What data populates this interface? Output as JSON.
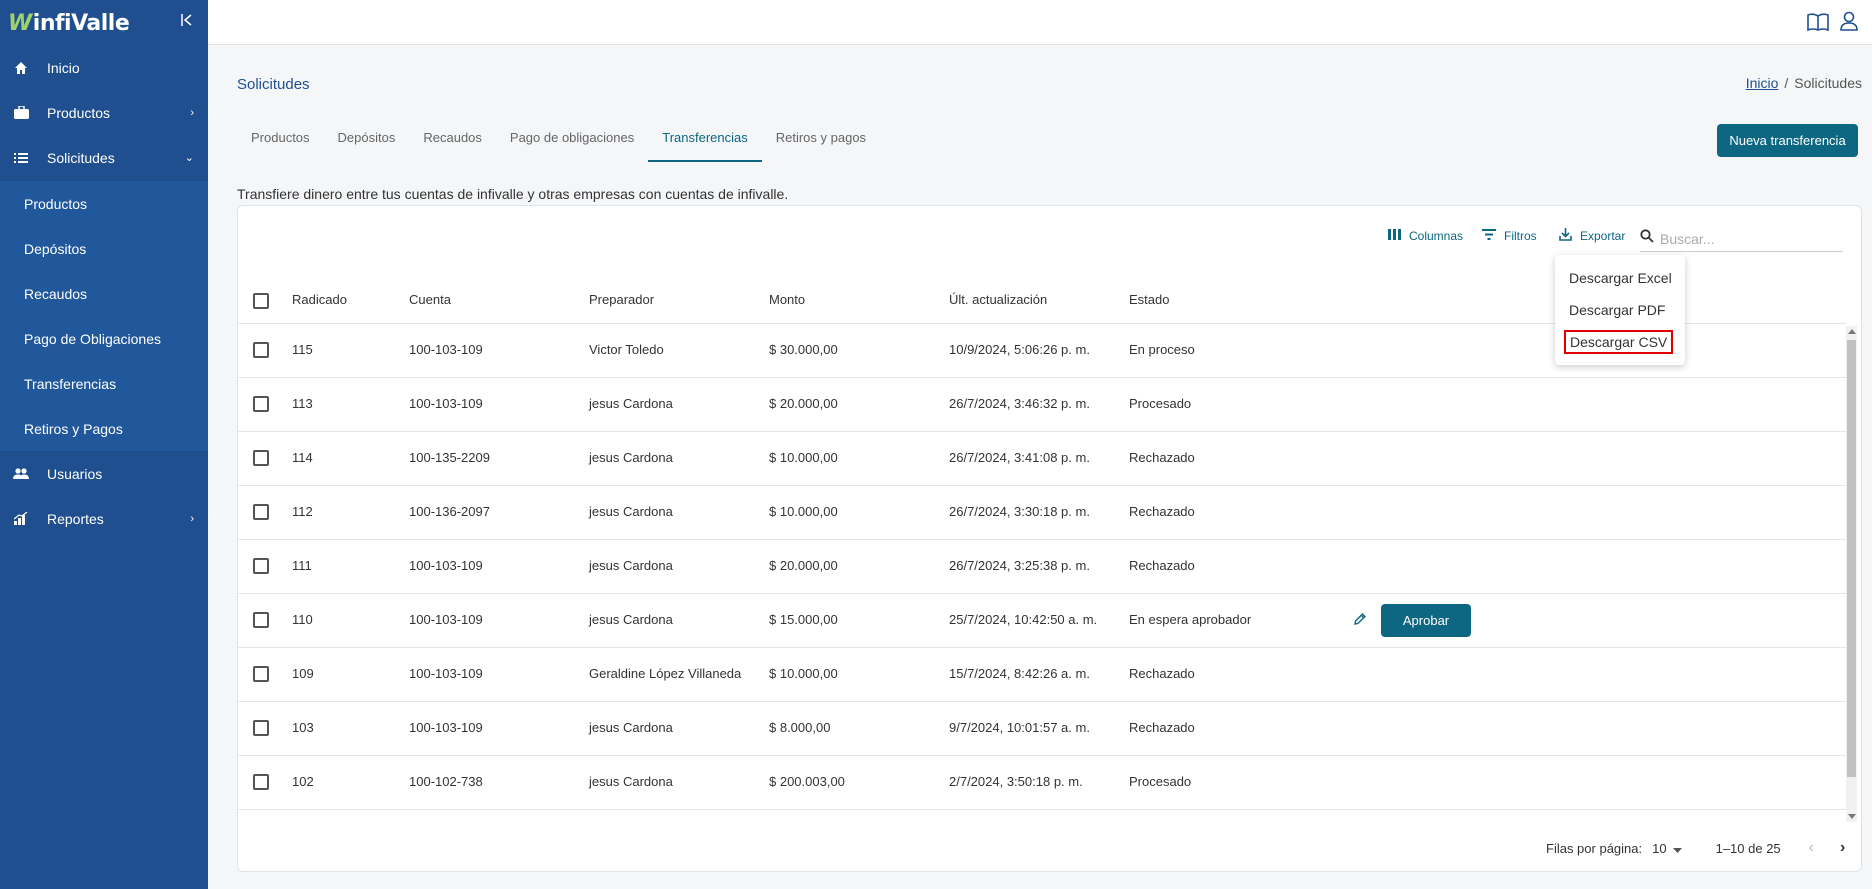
{
  "sidebar": {
    "logo_text": "infiValle",
    "nav": [
      {
        "label": "Inicio",
        "icon": "home-icon"
      },
      {
        "label": "Productos",
        "icon": "briefcase-icon",
        "chevron": "›"
      },
      {
        "label": "Solicitudes",
        "icon": "list-icon",
        "chevron": "⌄"
      },
      {
        "label": "Usuarios",
        "icon": "users-icon"
      },
      {
        "label": "Reportes",
        "icon": "bar-chart-icon",
        "chevron": "›"
      }
    ],
    "sub_items": [
      "Productos",
      "Depósitos",
      "Recaudos",
      "Pago de Obligaciones",
      "Transferencias",
      "Retiros y Pagos"
    ]
  },
  "header": {
    "page_title": "Solicitudes",
    "breadcrumb": {
      "home": "Inicio",
      "separator": "/",
      "current": "Solicitudes"
    }
  },
  "tabs": [
    "Productos",
    "Depósitos",
    "Recaudos",
    "Pago de obligaciones",
    "Transferencias",
    "Retiros y pagos"
  ],
  "active_tab": "Transferencias",
  "new_button": "Nueva transferencia",
  "description": "Transfiere dinero entre tus cuentas de infivalle y otras empresas con cuentas de infivalle.",
  "toolbar": {
    "columns": "Columnas",
    "filters": "Filtros",
    "export": "Exportar",
    "search_placeholder": "Buscar..."
  },
  "export_menu": [
    "Descargar Excel",
    "Descargar PDF",
    "Descargar CSV"
  ],
  "table": {
    "headers": [
      "Radicado",
      "Cuenta",
      "Preparador",
      "Monto",
      "Últ. actualización",
      "Estado"
    ],
    "rows": [
      {
        "radicado": "115",
        "cuenta": "100-103-109",
        "preparador": "Victor Toledo",
        "monto": "$ 30.000,00",
        "fecha": "10/9/2024, 5:06:26 p. m.",
        "estado": "En proceso"
      },
      {
        "radicado": "113",
        "cuenta": "100-103-109",
        "preparador": "jesus Cardona",
        "monto": "$ 20.000,00",
        "fecha": "26/7/2024, 3:46:32 p. m.",
        "estado": "Procesado"
      },
      {
        "radicado": "114",
        "cuenta": "100-135-2209",
        "preparador": "jesus Cardona",
        "monto": "$ 10.000,00",
        "fecha": "26/7/2024, 3:41:08 p. m.",
        "estado": "Rechazado"
      },
      {
        "radicado": "112",
        "cuenta": "100-136-2097",
        "preparador": "jesus Cardona",
        "monto": "$ 10.000,00",
        "fecha": "26/7/2024, 3:30:18 p. m.",
        "estado": "Rechazado"
      },
      {
        "radicado": "111",
        "cuenta": "100-103-109",
        "preparador": "jesus Cardona",
        "monto": "$ 20.000,00",
        "fecha": "26/7/2024, 3:25:38 p. m.",
        "estado": "Rechazado"
      },
      {
        "radicado": "110",
        "cuenta": "100-103-109",
        "preparador": "jesus Cardona",
        "monto": "$ 15.000,00",
        "fecha": "25/7/2024, 10:42:50 a. m.",
        "estado": "En espera aprobador",
        "action": "Aprobar"
      },
      {
        "radicado": "109",
        "cuenta": "100-103-109",
        "preparador": "Geraldine López Villaneda",
        "monto": "$ 10.000,00",
        "fecha": "15/7/2024, 8:42:26 a. m.",
        "estado": "Rechazado"
      },
      {
        "radicado": "103",
        "cuenta": "100-103-109",
        "preparador": "jesus Cardona",
        "monto": "$ 8.000,00",
        "fecha": "9/7/2024, 10:01:57 a. m.",
        "estado": "Rechazado"
      },
      {
        "radicado": "102",
        "cuenta": "100-102-738",
        "preparador": "jesus Cardona",
        "monto": "$ 200.003,00",
        "fecha": "2/7/2024, 3:50:18 p. m.",
        "estado": "Procesado"
      }
    ]
  },
  "pagination": {
    "rows_label": "Filas por página:",
    "rows_value": "10",
    "range": "1–10 de 25"
  },
  "colors": {
    "sidebar": "#1f4f8f",
    "accent": "#0e6782",
    "highlight_border": "#e00000"
  }
}
